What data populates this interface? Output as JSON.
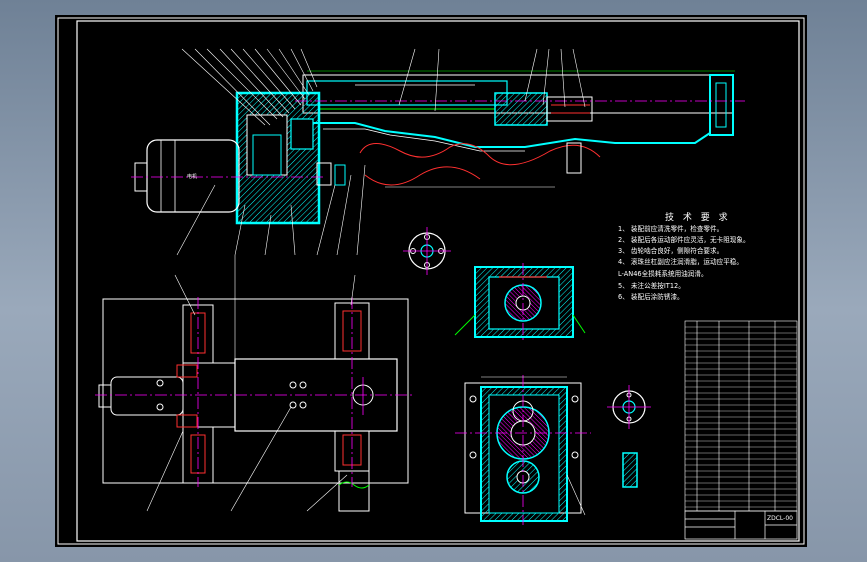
{
  "drawing": {
    "colors": {
      "background": "#000000",
      "frame": "#ffffff",
      "outline": "#00ffff",
      "center_line": "#ff00ff",
      "section": "#ff3030",
      "dimension": "#00ff00",
      "leader": "#ffffff"
    },
    "tech_requirements": {
      "title": "技 术 要 求",
      "items": [
        "1、 装配前应清洗零件，检查零件。",
        "2、 装配后各运动部件应灵活，无卡阻现象。",
        "3、 齿轮啮合良好，侧隙符合要求。",
        "4、 滚珠丝杠副应注润滑脂，运动应平稳。",
        "L-AN46全损耗系统用油润滑。",
        "5、 未注公差按IT12。",
        "6、 装配后涂防锈漆。"
      ]
    },
    "motor_label": "电机",
    "title_block": {
      "drawing_no": "ZDCL-00"
    }
  }
}
